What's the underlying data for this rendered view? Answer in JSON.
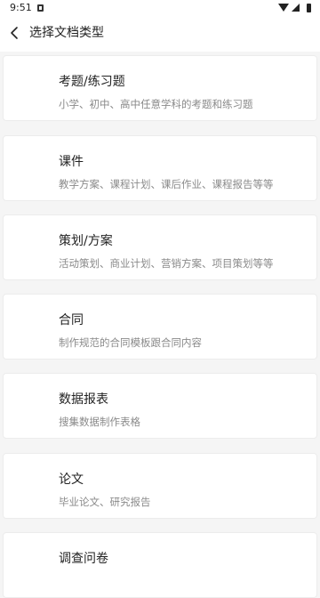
{
  "status_bar": {
    "time": "9:51"
  },
  "header": {
    "title": "选择文档类型"
  },
  "items": [
    {
      "title": "考题/练习题",
      "desc": "小学、初中、高中任意学科的考题和练习题"
    },
    {
      "title": "课件",
      "desc": "教学方案、课程计划、课后作业、课程报告等等"
    },
    {
      "title": "策划/方案",
      "desc": "活动策划、商业计划、营销方案、项目策划等等"
    },
    {
      "title": "合同",
      "desc": "制作规范的合同模板跟合同内容"
    },
    {
      "title": "数据报表",
      "desc": "搜集数据制作表格"
    },
    {
      "title": "论文",
      "desc": "毕业论文、研究报告"
    },
    {
      "title": "调查问卷",
      "desc": ""
    }
  ]
}
